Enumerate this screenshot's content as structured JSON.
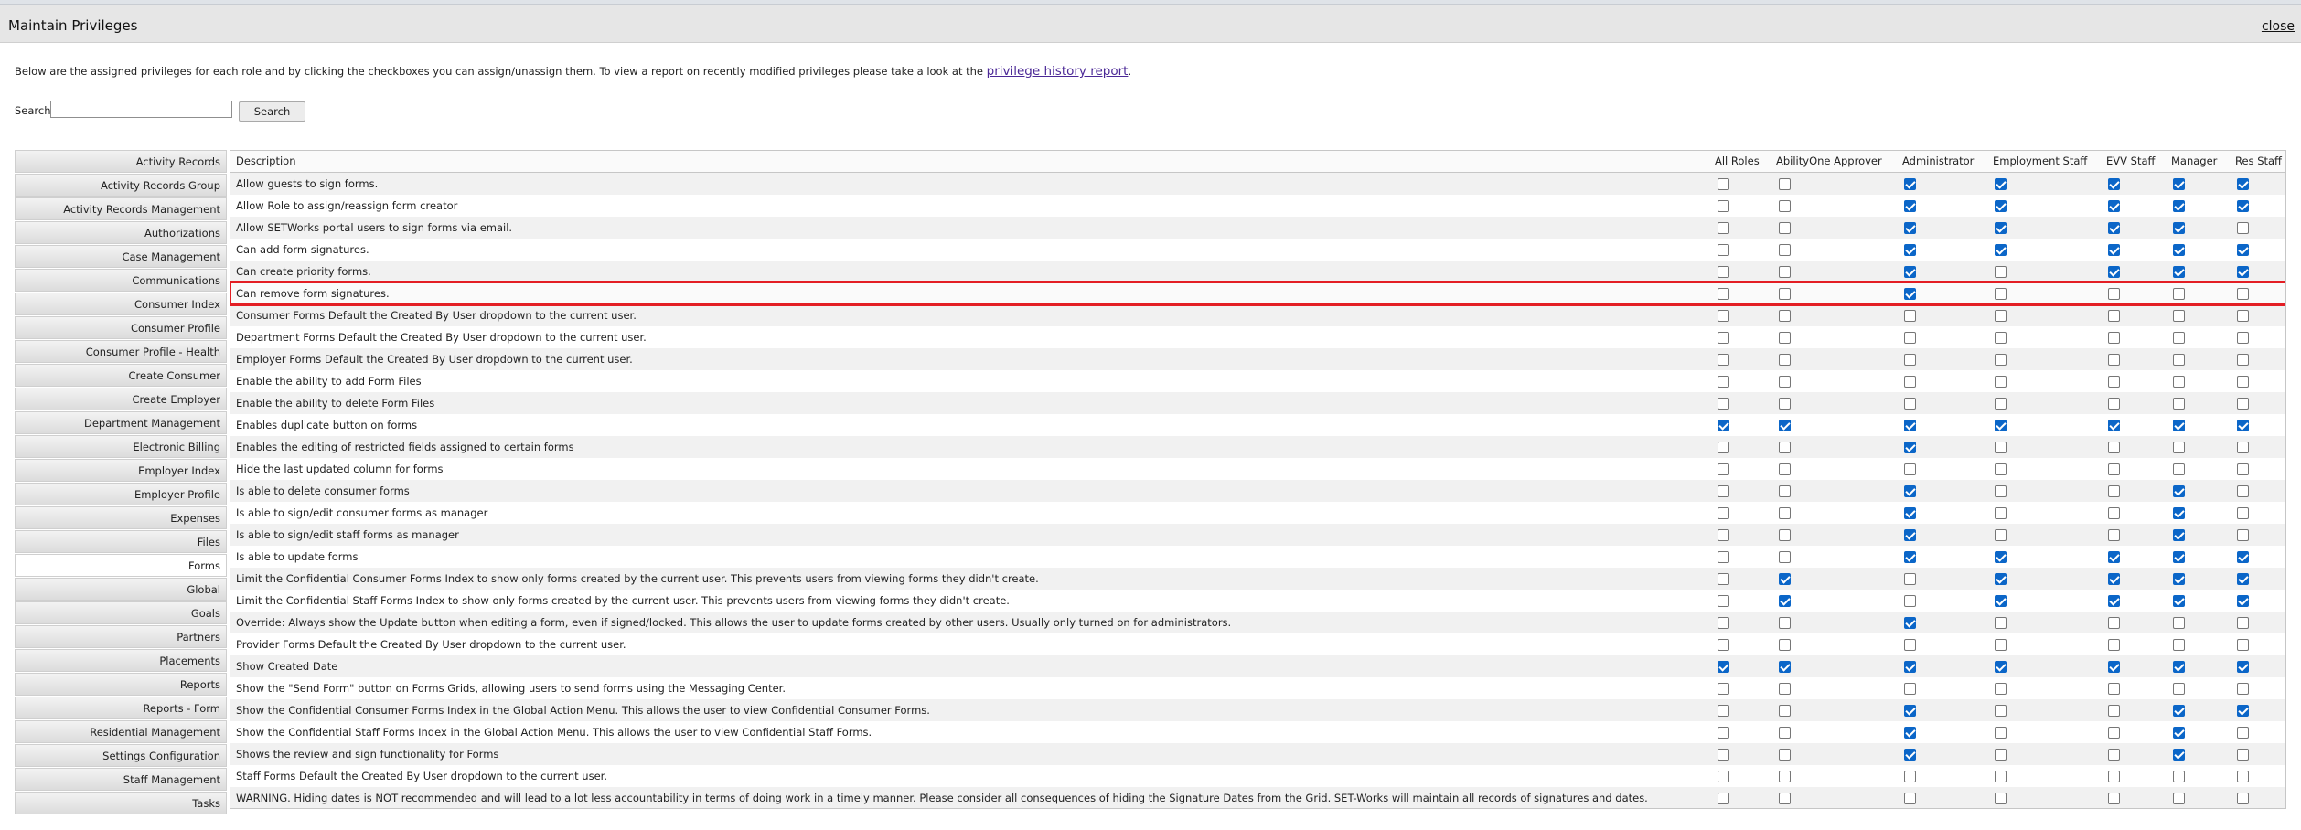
{
  "dialog": {
    "title": "Maintain Privileges",
    "close_label": "close",
    "intro_text": "Below are the assigned privileges for each role and by clicking the checkboxes you can assign/unassign them.   To view a report on recently modified privileges please take a look at the ",
    "intro_link": "privilege history report",
    "intro_end": "."
  },
  "search": {
    "label": "Search:",
    "value": "",
    "placeholder": "",
    "button_label": "Search"
  },
  "categories": [
    "Activity Records",
    "Activity Records Group",
    "Activity Records Management",
    "Authorizations",
    "Case Management",
    "Communications",
    "Consumer Index",
    "Consumer Profile",
    "Consumer Profile - Health",
    "Create Consumer",
    "Create Employer",
    "Department Management",
    "Electronic Billing",
    "Employer Index",
    "Employer Profile",
    "Expenses",
    "Files",
    "Forms",
    "Global",
    "Goals",
    "Partners",
    "Placements",
    "Reports",
    "Reports - Form",
    "Residential Management",
    "Settings Configuration",
    "Staff Management",
    "Tasks"
  ],
  "selected_category": "Forms",
  "table": {
    "description_header": "Description",
    "roles": [
      "All Roles",
      "AbilityOne Approver",
      "Administrator",
      "Employment Staff",
      "EVV Staff",
      "Manager",
      "Res Staff"
    ],
    "highlighted_row": 5,
    "rows": [
      {
        "description": "Allow guests to sign forms.",
        "checks": [
          0,
          0,
          1,
          1,
          1,
          1,
          1
        ]
      },
      {
        "description": "Allow Role to assign/reassign form creator",
        "checks": [
          0,
          0,
          1,
          1,
          1,
          1,
          1
        ]
      },
      {
        "description": "Allow SETWorks portal users to sign forms via email.",
        "checks": [
          0,
          0,
          1,
          1,
          1,
          1,
          0
        ]
      },
      {
        "description": "Can add form signatures.",
        "checks": [
          0,
          0,
          1,
          1,
          1,
          1,
          1
        ]
      },
      {
        "description": "Can create priority forms.",
        "checks": [
          0,
          0,
          1,
          0,
          1,
          1,
          1
        ]
      },
      {
        "description": "Can remove form signatures.",
        "checks": [
          0,
          0,
          1,
          0,
          0,
          0,
          0
        ]
      },
      {
        "description": "Consumer Forms Default the Created By User dropdown to the current user.",
        "checks": [
          0,
          0,
          0,
          0,
          0,
          0,
          0
        ]
      },
      {
        "description": "Department Forms Default the Created By User dropdown to the current user.",
        "checks": [
          0,
          0,
          0,
          0,
          0,
          0,
          0
        ]
      },
      {
        "description": "Employer Forms Default the Created By User dropdown to the current user.",
        "checks": [
          0,
          0,
          0,
          0,
          0,
          0,
          0
        ]
      },
      {
        "description": "Enable the ability to add Form Files",
        "checks": [
          0,
          0,
          0,
          0,
          0,
          0,
          0
        ]
      },
      {
        "description": "Enable the ability to delete Form Files",
        "checks": [
          0,
          0,
          0,
          0,
          0,
          0,
          0
        ]
      },
      {
        "description": "Enables duplicate button on forms",
        "checks": [
          1,
          1,
          1,
          1,
          1,
          1,
          1
        ]
      },
      {
        "description": "Enables the editing of restricted fields assigned to certain forms",
        "checks": [
          0,
          0,
          1,
          0,
          0,
          0,
          0
        ]
      },
      {
        "description": "Hide the last updated column for forms",
        "checks": [
          0,
          0,
          0,
          0,
          0,
          0,
          0
        ]
      },
      {
        "description": "Is able to delete consumer forms",
        "checks": [
          0,
          0,
          1,
          0,
          0,
          1,
          0
        ]
      },
      {
        "description": "Is able to sign/edit consumer forms as manager",
        "checks": [
          0,
          0,
          1,
          0,
          0,
          1,
          0
        ]
      },
      {
        "description": "Is able to sign/edit staff forms as manager",
        "checks": [
          0,
          0,
          1,
          0,
          0,
          1,
          0
        ]
      },
      {
        "description": "Is able to update forms",
        "checks": [
          0,
          0,
          1,
          1,
          1,
          1,
          1
        ]
      },
      {
        "description": "Limit the Confidential Consumer Forms Index to show only forms created by the current user. This prevents users from viewing forms they didn't create.",
        "checks": [
          0,
          1,
          0,
          1,
          1,
          1,
          1
        ]
      },
      {
        "description": "Limit the Confidential Staff Forms Index to show only forms created by the current user. This prevents users from viewing forms they didn't create.",
        "checks": [
          0,
          1,
          0,
          1,
          1,
          1,
          1
        ]
      },
      {
        "description": "Override: Always show the Update button when editing a form, even if signed/locked. This allows the user to update forms created by other users. Usually only turned on for administrators.",
        "checks": [
          0,
          0,
          1,
          0,
          0,
          0,
          0
        ]
      },
      {
        "description": "Provider Forms Default the Created By User dropdown to the current user.",
        "checks": [
          0,
          0,
          0,
          0,
          0,
          0,
          0
        ]
      },
      {
        "description": "Show Created Date",
        "checks": [
          1,
          1,
          1,
          1,
          1,
          1,
          1
        ]
      },
      {
        "description": "Show the \"Send Form\" button on Forms Grids, allowing users to send forms using the Messaging Center.",
        "checks": [
          0,
          0,
          0,
          0,
          0,
          0,
          0
        ]
      },
      {
        "description": "Show the Confidential Consumer Forms Index in the Global Action Menu. This allows the user to view Confidential Consumer Forms.",
        "checks": [
          0,
          0,
          1,
          0,
          0,
          1,
          1
        ]
      },
      {
        "description": "Show the Confidential Staff Forms Index in the Global Action Menu. This allows the user to view Confidential Staff Forms.",
        "checks": [
          0,
          0,
          1,
          0,
          0,
          1,
          0
        ]
      },
      {
        "description": "Shows the review and sign functionality for Forms",
        "checks": [
          0,
          0,
          1,
          0,
          0,
          1,
          0
        ]
      },
      {
        "description": "Staff Forms Default the Created By User dropdown to the current user.",
        "checks": [
          0,
          0,
          0,
          0,
          0,
          0,
          0
        ]
      },
      {
        "description": "WARNING. Hiding dates is NOT recommended and will lead to a lot less accountability in terms of doing work in a timely manner. Please consider all consequences of hiding the Signature Dates from the Grid. SET-Works will maintain all records of signatures and dates.",
        "checks": [
          0,
          0,
          0,
          0,
          0,
          0,
          0
        ]
      }
    ]
  },
  "colors": {
    "checkbox_checked": "#0b66c8",
    "highlight_border": "#e31e24",
    "link": "#4b2896"
  }
}
